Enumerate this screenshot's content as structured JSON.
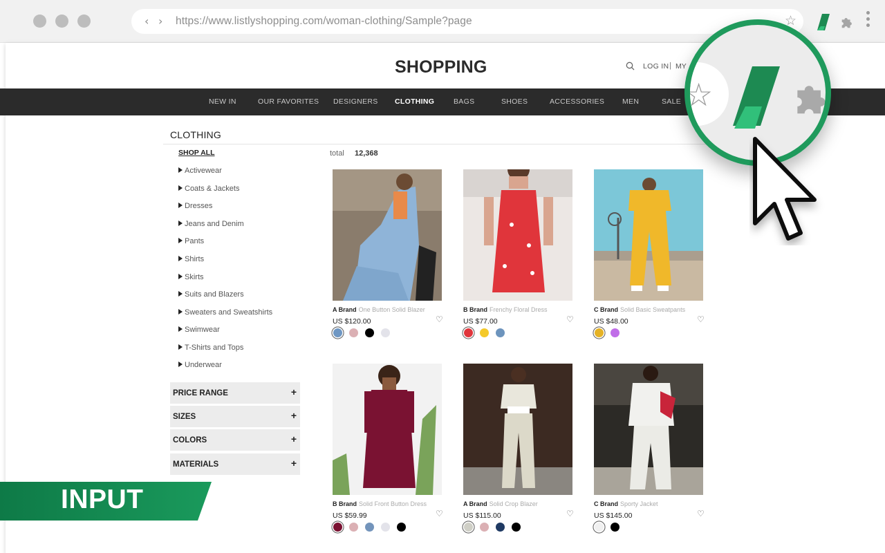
{
  "browser": {
    "url": "https://www.listlyshopping.com/woman-clothing/Sample?page",
    "back_glyph": "‹",
    "forward_glyph": "›",
    "star_glyph": "☆"
  },
  "header": {
    "logo": "SHOPPING",
    "login": "LOG IN",
    "separator": "|",
    "account": "MY"
  },
  "nav": {
    "items": [
      "NEW IN",
      "OUR FAVORITES",
      "DESIGNERS",
      "CLOTHING",
      "BAGS",
      "SHOES",
      "ACCESSORIES",
      "MEN",
      "SALE"
    ],
    "active": "CLOTHING"
  },
  "sidebar": {
    "title": "CLOTHING",
    "shop_all": "SHOP ALL",
    "subcategories": [
      "Activewear",
      "Coats & Jackets",
      "Dresses",
      "Jeans and Denim",
      "Pants",
      "Shirts",
      "Skirts",
      "Suits and Blazers",
      "Sweaters and Sweatshirts",
      "Swimwear",
      "T-Shirts and Tops",
      "Underwear"
    ],
    "filters": [
      "PRICE RANGE",
      "SIZES",
      "COLORS",
      "MATERIALS"
    ],
    "plus": "+"
  },
  "listing": {
    "total_label": "total",
    "total_value": "12,368",
    "heart_glyph": "♡",
    "products": [
      {
        "brand": "A Brand",
        "name": "One Button Solid Blazer",
        "price": "US $120.00",
        "swatches": [
          "#6f97c3",
          "#dbb0b4",
          "#000000",
          "#e3e3ea"
        ]
      },
      {
        "brand": "B Brand",
        "name": "Frenchy Floral Dress",
        "price": "US $77.00",
        "swatches": [
          "#e0353b",
          "#f4c92a",
          "#6d94bd"
        ]
      },
      {
        "brand": "C Brand",
        "name": "Solid Basic Sweatpants",
        "price": "US $48.00",
        "swatches": [
          "#e5b225",
          "#c06ee8"
        ]
      },
      {
        "brand": "B Brand",
        "name": "Solid Front Button Dress",
        "price": "US $59.99",
        "swatches": [
          "#7a1232",
          "#dbb0b4",
          "#7394bb",
          "#e3e3ea",
          "#000000"
        ]
      },
      {
        "brand": "A Brand",
        "name": "Solid Crop Blazer",
        "price": "US $115.00",
        "swatches": [
          "#cfcfc6",
          "#dbb0b4",
          "#1f3a63",
          "#000000"
        ]
      },
      {
        "brand": "C Brand",
        "name": "Sporty Jacket",
        "price": "US $145.00",
        "swatches": [
          "#f0f0f0",
          "#000000"
        ]
      }
    ]
  },
  "banner": {
    "label": "INPUT"
  },
  "colors": {
    "accent_green": "#1f9a5c",
    "navbar": "#2b2b2b",
    "banner_green": "#0e7a47"
  }
}
